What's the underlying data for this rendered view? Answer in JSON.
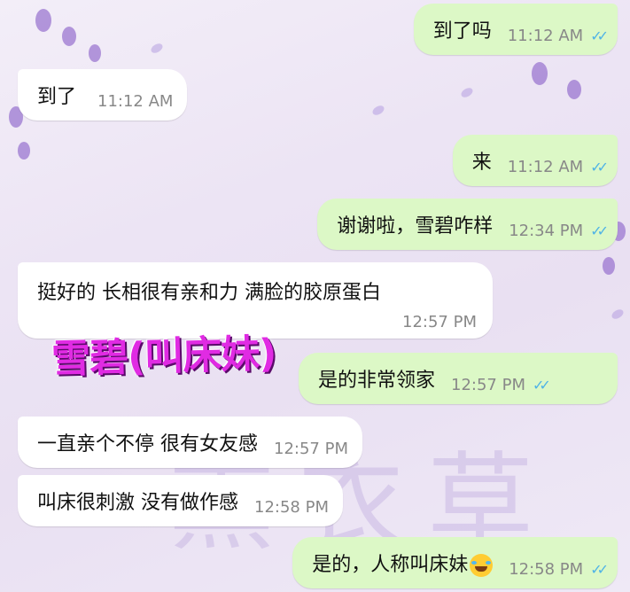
{
  "messages": [
    {
      "dir": "out",
      "text": "到了吗",
      "time": "11:12 AM"
    },
    {
      "dir": "in",
      "text": "到了",
      "time": "11:12 AM"
    },
    {
      "dir": "out",
      "text": "来",
      "time": "11:12 AM"
    },
    {
      "dir": "out",
      "text": "谢谢啦，雪碧咋样",
      "time": "12:34 PM"
    },
    {
      "dir": "in",
      "text": "挺好的 长相很有亲和力 满脸的胶原蛋白",
      "time": "12:57 PM"
    },
    {
      "dir": "out",
      "text": "是的非常领家",
      "time": "12:57 PM"
    },
    {
      "dir": "in",
      "text": "一直亲个不停 很有女友感",
      "time": "12:57 PM"
    },
    {
      "dir": "in",
      "text": "叫床很刺激 没有做作感",
      "time": "12:58 PM"
    },
    {
      "dir": "out",
      "text": "是的，人称叫床妹",
      "time": "12:58 PM"
    }
  ],
  "overlay_caption": "雪碧(叫床妹)",
  "read_ticks": "✓✓",
  "emoji_name": "tears-of-joy-emoji",
  "colors": {
    "outgoing": "#dcf8c6",
    "incoming": "#ffffff",
    "overlay": "#e02be3",
    "ticks": "#4fb3e6"
  }
}
